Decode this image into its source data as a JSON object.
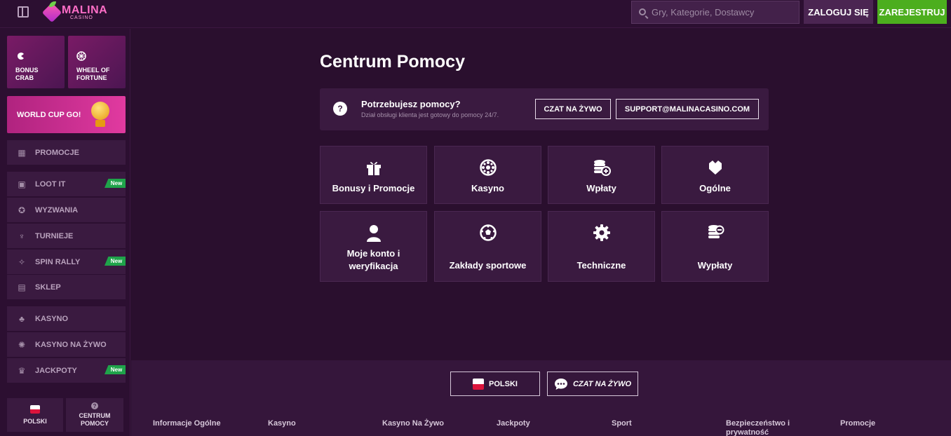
{
  "topbar": {
    "logo_text": "MALINA",
    "logo_sub": "CASINO",
    "search_placeholder": "Gry, Kategorie, Dostawcy",
    "login_label": "ZALOGUJ SIĘ",
    "register_label": "ZAREJESTRUJ"
  },
  "sidebar": {
    "tiles": [
      {
        "label_line1": "BONUS",
        "label_line2": "CRAB"
      },
      {
        "label_line1": "WHEEL OF",
        "label_line2": "FORTUNE"
      }
    ],
    "world_cup_label": "WORLD CUP GO!",
    "items": [
      {
        "label": "PROMOCJE"
      },
      {
        "label": "LOOT IT",
        "badge": "New"
      },
      {
        "label": "WYZWANIA"
      },
      {
        "label": "TURNIEJE"
      },
      {
        "label": "SPIN RALLY",
        "badge": "New"
      },
      {
        "label": "SKLEP"
      },
      {
        "label": "KASYNO"
      },
      {
        "label": "KASYNO NA ŻYWO"
      },
      {
        "label": "JACKPOTY",
        "badge": "New"
      }
    ],
    "footer": {
      "language_label": "POLSKI",
      "help_line1": "CENTRUM",
      "help_line2": "POMOCY"
    }
  },
  "main": {
    "title": "Centrum Pomocy",
    "help": {
      "title": "Potrzebujesz pomocy?",
      "subtitle": "Dział obsługi klienta jest gotowy do pomocy 24/7.",
      "chat_label": "CZAT NA ŻYWO",
      "email_label": "SUPPORT@MALINACASINO.COM"
    },
    "categories": [
      {
        "label": "Bonusy i Promocje",
        "icon": "gift-icon"
      },
      {
        "label": "Kasyno",
        "icon": "roulette-icon"
      },
      {
        "label": "Wpłaty",
        "icon": "coins-plus-icon"
      },
      {
        "label": "Ogólne",
        "icon": "crown-icon"
      },
      {
        "label_line1": "Moje konto i",
        "label_line2": "weryfikacja",
        "icon": "user-icon"
      },
      {
        "label": "Zakłady sportowe",
        "icon": "soccer-ball-icon"
      },
      {
        "label": "Techniczne",
        "icon": "gear-icon"
      },
      {
        "label": "Wypłaty",
        "icon": "coins-minus-icon"
      }
    ]
  },
  "footer": {
    "language_label": "POLSKI",
    "chat_label": "CZAT NA ŻYWO",
    "columns": [
      {
        "line1": "Informacje Ogólne"
      },
      {
        "line1": "Kasyno"
      },
      {
        "line1": "Kasyno Na Żywo"
      },
      {
        "line1": "Jackpoty"
      },
      {
        "line1": "Sport"
      },
      {
        "line1": "Bezpieczeństwo i",
        "line2": "prywatność"
      },
      {
        "line1": "Promocje"
      }
    ]
  },
  "colors": {
    "background": "#2a0f2e",
    "panel": "#3a1a40",
    "accent_green": "#4cae1e",
    "accent_pink": "#e13aa0",
    "badge_green": "#1fa34a"
  }
}
